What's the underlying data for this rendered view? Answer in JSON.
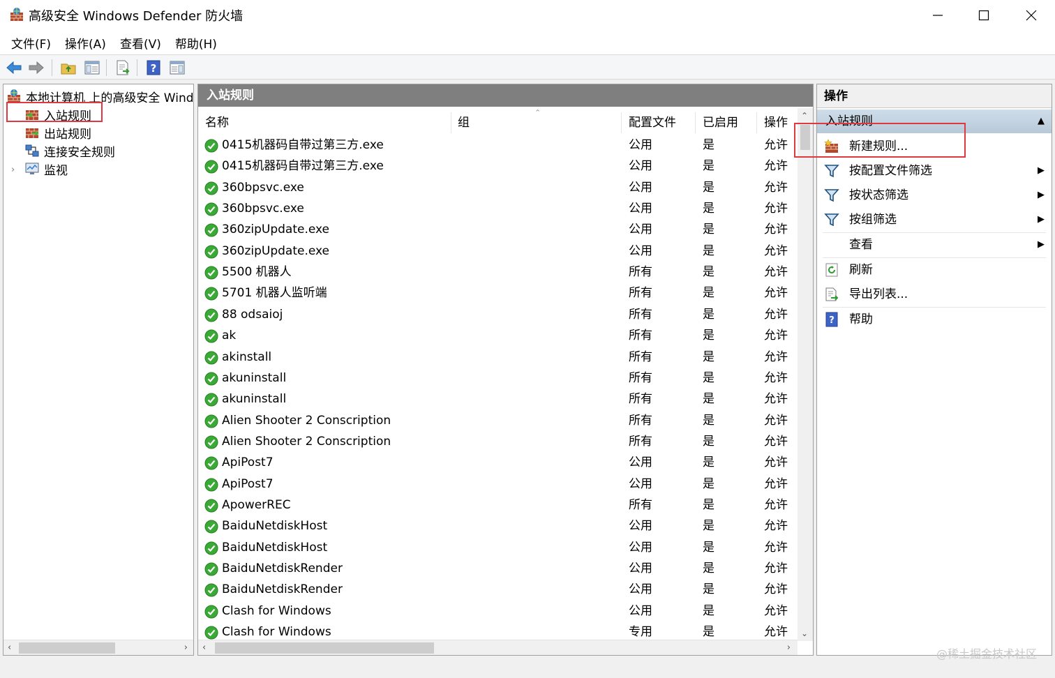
{
  "window": {
    "title": "高级安全 Windows Defender 防火墙",
    "minimize_icon": "minimize-icon",
    "maximize_icon": "maximize-icon",
    "close_icon": "close-icon"
  },
  "menu": [
    "文件(F)",
    "操作(A)",
    "查看(V)",
    "帮助(H)"
  ],
  "toolbar": {
    "icons": [
      "back-arrow-icon",
      "forward-arrow-icon",
      "folder-up-icon",
      "show-hide-tree-icon",
      "export-list-icon",
      "help-icon",
      "show-hide-action-pane-icon"
    ]
  },
  "tree": {
    "root": "本地计算机 上的高级安全 Windows Defender 防火墙",
    "items": [
      {
        "label": "入站规则",
        "icon": "inbound-rules-icon",
        "selected": true
      },
      {
        "label": "出站规则",
        "icon": "outbound-rules-icon",
        "selected": false
      },
      {
        "label": "连接安全规则",
        "icon": "connection-security-icon",
        "selected": false
      },
      {
        "label": "监视",
        "icon": "monitoring-icon",
        "selected": false
      }
    ]
  },
  "main": {
    "title": "入站规则",
    "columns": {
      "name": "名称",
      "group": "组",
      "profile": "配置文件",
      "enabled": "已启用",
      "action": "操作"
    },
    "rows": [
      {
        "name": "0415机器码自带过第三方.exe",
        "group": "",
        "profile": "公用",
        "enabled": "是",
        "action": "允许"
      },
      {
        "name": "0415机器码自带过第三方.exe",
        "group": "",
        "profile": "公用",
        "enabled": "是",
        "action": "允许"
      },
      {
        "name": "360bpsvc.exe",
        "group": "",
        "profile": "公用",
        "enabled": "是",
        "action": "允许"
      },
      {
        "name": "360bpsvc.exe",
        "group": "",
        "profile": "公用",
        "enabled": "是",
        "action": "允许"
      },
      {
        "name": "360zipUpdate.exe",
        "group": "",
        "profile": "公用",
        "enabled": "是",
        "action": "允许"
      },
      {
        "name": "360zipUpdate.exe",
        "group": "",
        "profile": "公用",
        "enabled": "是",
        "action": "允许"
      },
      {
        "name": "5500 机器人",
        "group": "",
        "profile": "所有",
        "enabled": "是",
        "action": "允许"
      },
      {
        "name": "5701 机器人监听端",
        "group": "",
        "profile": "所有",
        "enabled": "是",
        "action": "允许"
      },
      {
        "name": "88 odsaioj",
        "group": "",
        "profile": "所有",
        "enabled": "是",
        "action": "允许"
      },
      {
        "name": "ak",
        "group": "",
        "profile": "所有",
        "enabled": "是",
        "action": "允许"
      },
      {
        "name": "akinstall",
        "group": "",
        "profile": "所有",
        "enabled": "是",
        "action": "允许"
      },
      {
        "name": "akuninstall",
        "group": "",
        "profile": "所有",
        "enabled": "是",
        "action": "允许"
      },
      {
        "name": "akuninstall",
        "group": "",
        "profile": "所有",
        "enabled": "是",
        "action": "允许"
      },
      {
        "name": "Alien Shooter 2 Conscription",
        "group": "",
        "profile": "所有",
        "enabled": "是",
        "action": "允许"
      },
      {
        "name": "Alien Shooter 2 Conscription",
        "group": "",
        "profile": "所有",
        "enabled": "是",
        "action": "允许"
      },
      {
        "name": "ApiPost7",
        "group": "",
        "profile": "公用",
        "enabled": "是",
        "action": "允许"
      },
      {
        "name": "ApiPost7",
        "group": "",
        "profile": "公用",
        "enabled": "是",
        "action": "允许"
      },
      {
        "name": "ApowerREC",
        "group": "",
        "profile": "所有",
        "enabled": "是",
        "action": "允许"
      },
      {
        "name": "BaiduNetdiskHost",
        "group": "",
        "profile": "公用",
        "enabled": "是",
        "action": "允许"
      },
      {
        "name": "BaiduNetdiskHost",
        "group": "",
        "profile": "公用",
        "enabled": "是",
        "action": "允许"
      },
      {
        "name": "BaiduNetdiskRender",
        "group": "",
        "profile": "公用",
        "enabled": "是",
        "action": "允许"
      },
      {
        "name": "BaiduNetdiskRender",
        "group": "",
        "profile": "公用",
        "enabled": "是",
        "action": "允许"
      },
      {
        "name": "Clash for Windows",
        "group": "",
        "profile": "公用",
        "enabled": "是",
        "action": "允许"
      },
      {
        "name": "Clash for Windows",
        "group": "",
        "profile": "专用",
        "enabled": "是",
        "action": "允许"
      }
    ],
    "row_icon": "allow-check-icon"
  },
  "actions": {
    "header": "操作",
    "section": "入站规则",
    "items": [
      {
        "label": "新建规则...",
        "icon": "new-rule-icon",
        "submenu": false
      },
      {
        "label": "按配置文件筛选",
        "icon": "filter-icon",
        "submenu": true
      },
      {
        "label": "按状态筛选",
        "icon": "filter-icon",
        "submenu": true
      },
      {
        "label": "按组筛选",
        "icon": "filter-icon",
        "submenu": true
      },
      {
        "label": "查看",
        "icon": "",
        "submenu": true
      },
      {
        "label": "刷新",
        "icon": "refresh-icon",
        "submenu": false
      },
      {
        "label": "导出列表...",
        "icon": "export-list-icon",
        "submenu": false
      },
      {
        "label": "帮助",
        "icon": "help-icon",
        "submenu": false
      }
    ]
  },
  "watermark": "@稀土掘金技术社区",
  "colors": {
    "highlight": "#e0383e",
    "header_gray": "#7f7f7f",
    "allow_green": "#3aa935"
  }
}
